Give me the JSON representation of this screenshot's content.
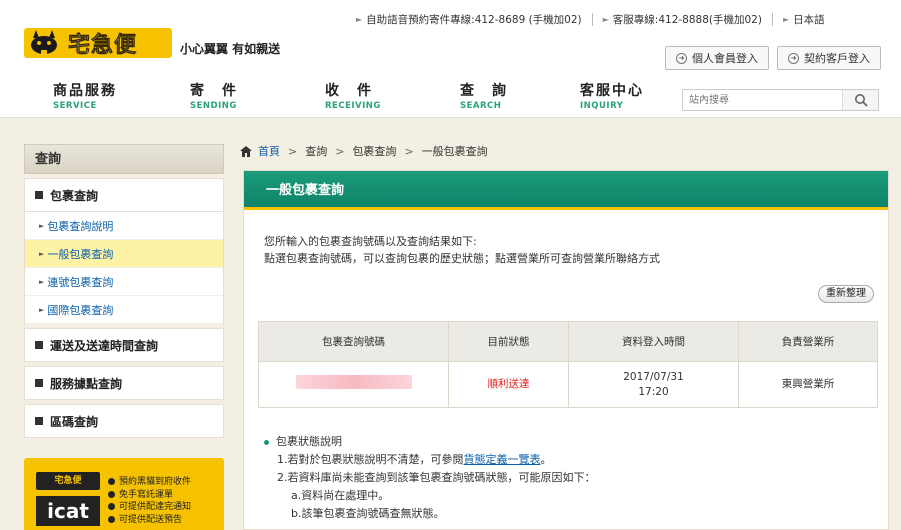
{
  "topbar": {
    "items": [
      "自助語音預約寄件專線:412-8689 (手機加02)",
      "客服專線:412-8888(手機加02)",
      "日本語"
    ]
  },
  "logo": {
    "text": "宅急便",
    "slogan": "小心翼翼 有如親送"
  },
  "login": {
    "member": "個人會員登入",
    "contract": "契約客戶登入"
  },
  "nav": [
    {
      "zh": "商品服務",
      "en": "SERVICE"
    },
    {
      "zh": "寄　件",
      "en": "SENDING"
    },
    {
      "zh": "收　件",
      "en": "RECEIVING"
    },
    {
      "zh": "查　詢",
      "en": "SEARCH"
    },
    {
      "zh": "客服中心",
      "en": "INQUIRY"
    }
  ],
  "search": {
    "placeholder": "站內搜尋"
  },
  "sidebar": {
    "title": "查詢",
    "cat_parcel": "包裹查詢",
    "sub_items": [
      "包裹查詢說明",
      "一般包裹查詢",
      "連號包裹查詢",
      "國際包裹查詢"
    ],
    "cat_delivery": "運送及送達時間查詢",
    "cat_location": "服務據點查詢",
    "cat_zip": "區碼查詢"
  },
  "promo": {
    "logo": "宅急便",
    "icat": "icat",
    "items": [
      "預約黑貓到府收件",
      "免手寫託運單",
      "可提供配達完通知",
      "可提供配送預告"
    ]
  },
  "breadcrumb": {
    "home": "首頁",
    "level1": "查詢",
    "level2": "包裹查詢",
    "current": "一般包裹查詢"
  },
  "panel": {
    "title": "一般包裹查詢",
    "intro_line1": "您所輸入的包裹查詢號碼以及查詢結果如下:",
    "intro_line2": "點選包裹查詢號碼，可以查詢包裹的歷史狀態；點選營業所可查詢營業所聯絡方式",
    "refresh": "重新整理"
  },
  "table": {
    "headers": [
      "包裹查詢號碼",
      "目前狀態",
      "資料登入時間",
      "負責營業所"
    ],
    "row": {
      "status": "順利送達",
      "date": "2017/07/31",
      "time": "17:20",
      "office": "東興營業所"
    }
  },
  "notes": {
    "heading": "包裹狀態說明",
    "line1_prefix": "1.若對於包裹狀態說明不清楚，可參閱",
    "line1_link": "貨態定義一覽表",
    "line1_suffix": "。",
    "line2": "2.若資料庫尚未能查詢到該筆包裹查詢號碼狀態，可能原因如下：",
    "line2a": "a.資料尚在處理中。",
    "line2b": "b.該筆包裹查詢號碼查無狀態。"
  },
  "colors": {
    "brand_yellow": "#f6c200",
    "header_green": "#0f8468",
    "status_red": "#e0201a",
    "link_blue": "#0a5fa8"
  }
}
